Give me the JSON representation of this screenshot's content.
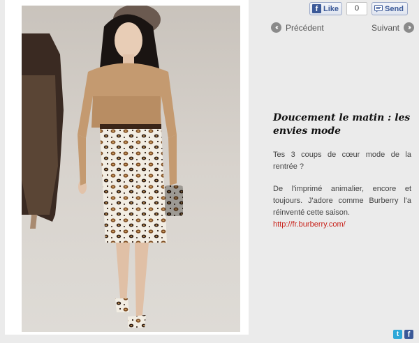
{
  "social": {
    "like_label": "Like",
    "like_count": "0",
    "send_label": "Send"
  },
  "nav": {
    "prev_label": "Précédent",
    "next_label": "Suivant"
  },
  "article": {
    "title": "Doucement le matin : les envies mode",
    "paragraph1": "Tes 3 coups de cœur mode de la rentrée ?",
    "paragraph2": "De l'imprimé animalier, encore et toujours. J'adore comme Burberry l'a réinventé cette saison.",
    "link": "http://fr.burberry.com/"
  },
  "icons": {
    "facebook": "facebook-icon",
    "twitter": "twitter-icon",
    "prev": "chevron-left-icon",
    "next": "chevron-right-icon"
  }
}
